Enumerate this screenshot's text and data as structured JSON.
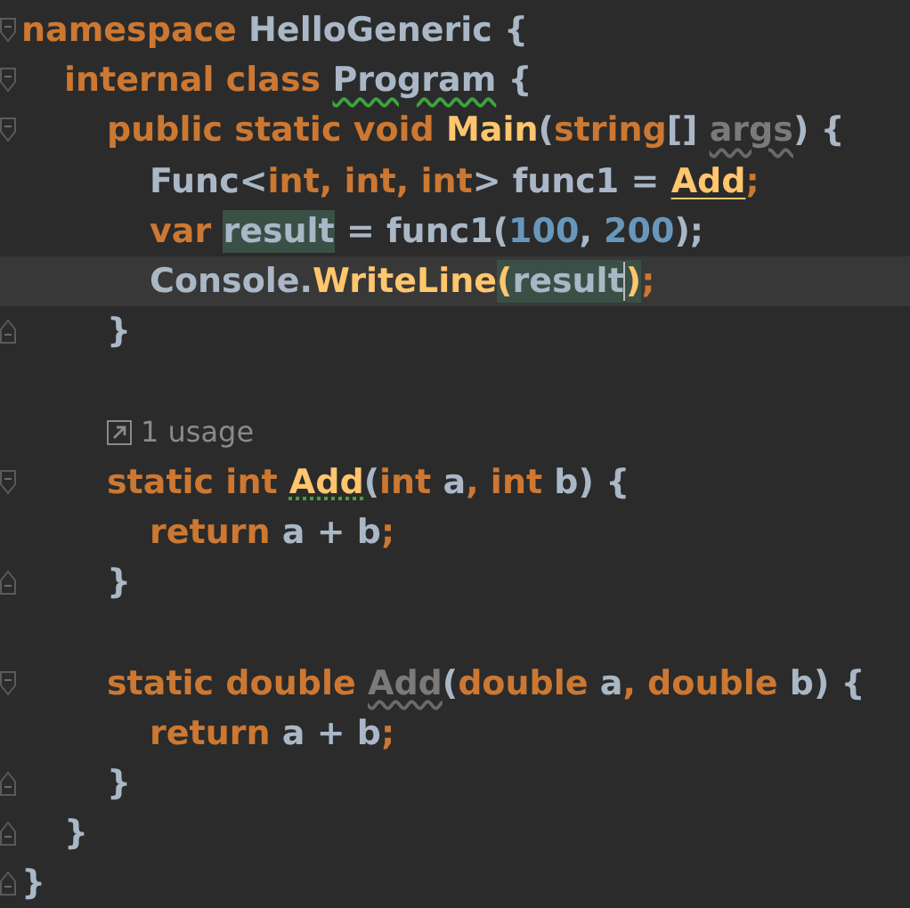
{
  "editor": {
    "lines": [
      {
        "current": false,
        "fold_start": true,
        "tokens": [
          {
            "kind": "keyword",
            "text": "namespace "
          },
          {
            "kind": "text",
            "text": "HelloGeneric {"
          }
        ]
      },
      {
        "current": false,
        "fold_start": true,
        "tokens": [
          {
            "kind": "keyword",
            "text": "\tinternal class "
          },
          {
            "kind": "text",
            "text": "Program",
            "warning": true
          },
          {
            "kind": "text",
            "text": " {"
          }
        ]
      },
      {
        "current": false,
        "fold_start": true,
        "tokens": [
          {
            "kind": "keyword",
            "text": "\t\tpublic static void "
          },
          {
            "kind": "method",
            "text": "Main"
          },
          {
            "kind": "text",
            "text": "("
          },
          {
            "kind": "keyword",
            "text": "string"
          },
          {
            "kind": "text",
            "text": "[] "
          },
          {
            "kind": "unused",
            "text": "args",
            "weak_warning": true
          },
          {
            "kind": "text",
            "text": ") {"
          }
        ]
      },
      {
        "current": false,
        "tokens": [
          {
            "kind": "text",
            "text": "\t\t\tFunc<"
          },
          {
            "kind": "keyword",
            "text": "int, int, int"
          },
          {
            "kind": "text",
            "text": "> func1 = "
          },
          {
            "kind": "method",
            "text": "Add",
            "usage_link": true
          },
          {
            "kind": "keyword",
            "text": ";"
          }
        ]
      },
      {
        "current": false,
        "tokens": [
          {
            "kind": "keyword",
            "text": "\t\t\tvar "
          },
          {
            "kind": "text",
            "text": "result",
            "highlighted": true
          },
          {
            "kind": "text",
            "text": " = func1("
          },
          {
            "kind": "number",
            "text": "100"
          },
          {
            "kind": "text",
            "text": ", "
          },
          {
            "kind": "number",
            "text": "200"
          },
          {
            "kind": "text",
            "text": ");"
          }
        ]
      },
      {
        "current": true,
        "tokens": [
          {
            "kind": "text",
            "text": "\t\t\tConsole."
          },
          {
            "kind": "method",
            "text": "WriteLine"
          },
          {
            "kind": "method",
            "text": "(",
            "highlighted": true
          },
          {
            "kind": "text",
            "text": "result",
            "highlighted": true,
            "caret": true
          },
          {
            "kind": "method",
            "text": ")",
            "highlighted": true
          },
          {
            "kind": "keyword",
            "text": ";"
          }
        ]
      },
      {
        "current": false,
        "fold_end": true,
        "tokens": [
          {
            "kind": "text",
            "text": "\t\t}"
          }
        ]
      },
      {
        "current": false
      },
      {
        "current": false,
        "tokens": [
          {
            "kind": "hint",
            "text": "\t\t1 usage"
          }
        ]
      },
      {
        "current": false,
        "fold_start": true,
        "tokens": [
          {
            "kind": "keyword",
            "text": "\t\tstatic int "
          },
          {
            "kind": "method",
            "text": "Add",
            "hint_dots": true
          },
          {
            "kind": "text",
            "text": "("
          },
          {
            "kind": "keyword",
            "text": "int "
          },
          {
            "kind": "text",
            "text": "a"
          },
          {
            "kind": "keyword",
            "text": ", int "
          },
          {
            "kind": "text",
            "text": "b) {"
          }
        ]
      },
      {
        "current": false,
        "tokens": [
          {
            "kind": "keyword",
            "text": "\t\t\treturn "
          },
          {
            "kind": "text",
            "text": "a + b"
          },
          {
            "kind": "keyword",
            "text": ";"
          }
        ]
      },
      {
        "current": false,
        "fold_end": true,
        "tokens": [
          {
            "kind": "text",
            "text": "\t\t}"
          }
        ]
      },
      {
        "current": false
      },
      {
        "current": false,
        "fold_start": true,
        "tokens": [
          {
            "kind": "keyword",
            "text": "\t\tstatic double "
          },
          {
            "kind": "unused",
            "text": "Add",
            "weak_warning": true
          },
          {
            "kind": "text",
            "text": "("
          },
          {
            "kind": "keyword",
            "text": "double "
          },
          {
            "kind": "text",
            "text": "a"
          },
          {
            "kind": "keyword",
            "text": ", double "
          },
          {
            "kind": "text",
            "text": "b) {"
          }
        ]
      },
      {
        "current": false,
        "tokens": [
          {
            "kind": "keyword",
            "text": "\t\t\treturn "
          },
          {
            "kind": "text",
            "text": "a + b"
          },
          {
            "kind": "keyword",
            "text": ";"
          }
        ]
      },
      {
        "current": false,
        "fold_end": true,
        "tokens": [
          {
            "kind": "text",
            "text": "\t\t}"
          }
        ]
      },
      {
        "current": false,
        "fold_end": true,
        "tokens": [
          {
            "kind": "text",
            "text": "\t}"
          }
        ]
      },
      {
        "current": false,
        "fold_end": true,
        "tokens": [
          {
            "kind": "text",
            "text": "}"
          }
        ]
      }
    ]
  }
}
